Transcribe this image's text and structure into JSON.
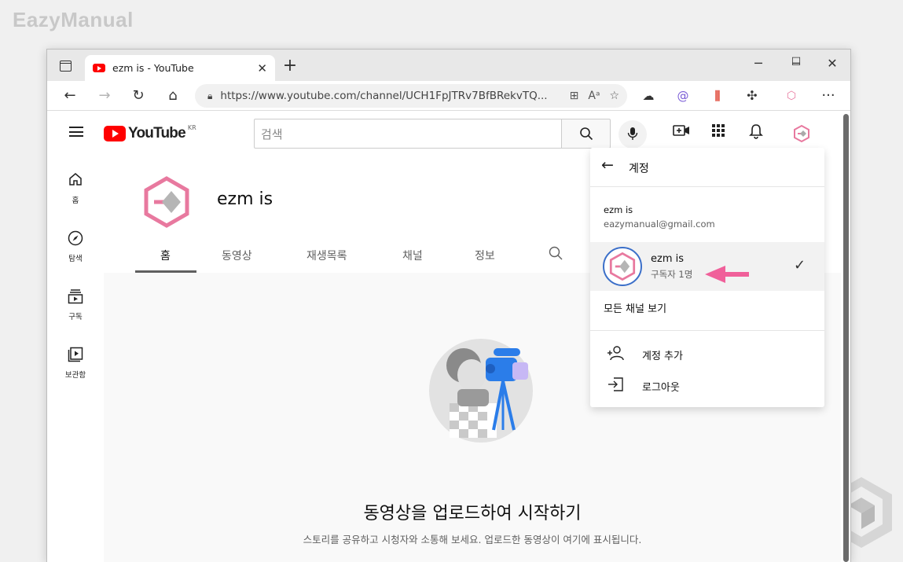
{
  "watermark": "EazyManual",
  "browser": {
    "tab_title": "ezm is - YouTube",
    "tab_close": "✕",
    "new_tab": "+",
    "window_controls": {
      "minimize": "─",
      "maximize": "☐",
      "close": "✕"
    },
    "nav": {
      "back": "←",
      "forward": "→",
      "reload": "↻",
      "home": "⌂"
    },
    "url": "https://www.youtube.com/channel/UCH1FpJTRv7BfBRekvTQ...",
    "more": "···"
  },
  "youtube": {
    "logo_text": "YouTube",
    "logo_region": "KR",
    "search_placeholder": "검색",
    "guide": [
      {
        "label": "홈",
        "icon": "home-icon"
      },
      {
        "label": "탐색",
        "icon": "compass-icon"
      },
      {
        "label": "구독",
        "icon": "subscriptions-icon"
      },
      {
        "label": "보관함",
        "icon": "library-icon"
      }
    ],
    "channel": {
      "name": "ezm is",
      "tabs": [
        "홈",
        "동영상",
        "재생목록",
        "채널",
        "정보"
      ],
      "active_tab": "홈"
    },
    "empty_state": {
      "title": "동영상을 업로드하여 시작하기",
      "subtitle": "스토리를 공유하고 시청자와 소통해 보세요. 업로드한 동영상이 여기에 표시됩니다."
    },
    "account_menu": {
      "title": "계정",
      "account_name": "ezm is",
      "email": "eazymanual@gmail.com",
      "current_channel": {
        "name": "ezm is",
        "subscribers": "구독자 1명"
      },
      "view_all_channels": "모든 채널 보기",
      "add_account": "계정 추가",
      "sign_out": "로그아웃"
    }
  },
  "colors": {
    "accent_pink": "#f0609a",
    "youtube_red": "#ff0000",
    "avatar_ring": "#3b6fc9"
  }
}
